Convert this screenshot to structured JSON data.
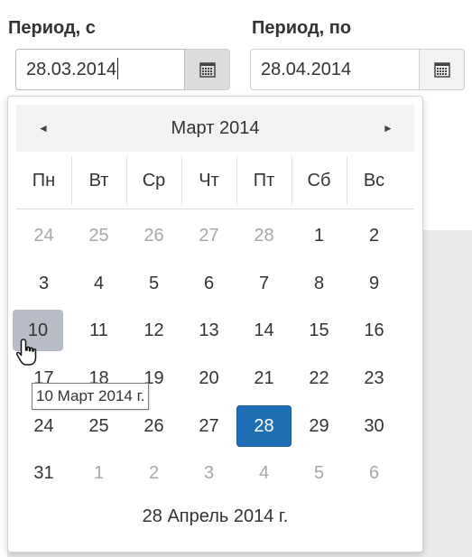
{
  "from": {
    "label": "Период, с",
    "value": "28.03.2014"
  },
  "to": {
    "label": "Период, по",
    "value": "28.04.2014"
  },
  "calendar": {
    "month_title": "Март 2014",
    "prev_glyph": "◄",
    "next_glyph": "►",
    "weekdays": [
      "Пн",
      "Вт",
      "Ср",
      "Чт",
      "Пт",
      "Сб",
      "Вс"
    ],
    "weeks": [
      [
        "24",
        "25",
        "26",
        "27",
        "28",
        "1",
        "2"
      ],
      [
        "3",
        "4",
        "5",
        "6",
        "7",
        "8",
        "9"
      ],
      [
        "10",
        "11",
        "12",
        "13",
        "14",
        "15",
        "16"
      ],
      [
        "17",
        "18",
        "19",
        "20",
        "21",
        "22",
        "23"
      ],
      [
        "24",
        "25",
        "26",
        "27",
        "28",
        "29",
        "30"
      ],
      [
        "31",
        "1",
        "2",
        "3",
        "4",
        "5",
        "6"
      ]
    ],
    "footer": "28 Апрель 2014 г."
  },
  "tooltip": "10 Март 2014 г.",
  "colors": {
    "selected": "#1f6fb4",
    "hover": "#b7bcc6",
    "other_month": "#a8a8a8"
  }
}
